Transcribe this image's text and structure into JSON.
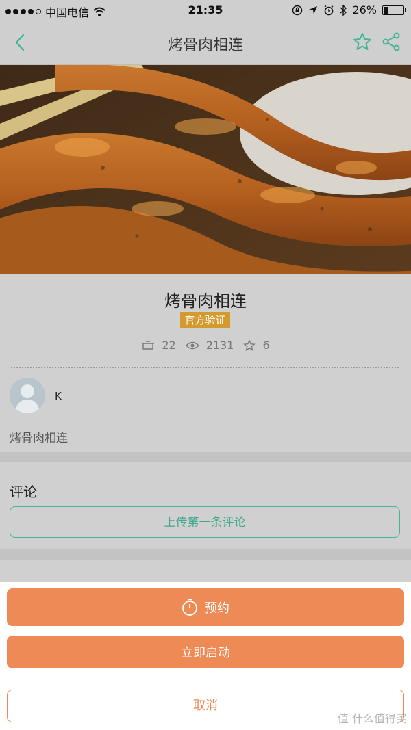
{
  "status_bar": {
    "carrier": "中国电信",
    "time": "21:35",
    "battery": "26%",
    "battery_level": 0.26
  },
  "nav": {
    "title": "烤骨肉相连",
    "back_icon": "chevron-left-icon",
    "favorite_icon": "star-icon",
    "share_icon": "share-icon",
    "accent_color": "#46b49a"
  },
  "recipe": {
    "title": "烤骨肉相连",
    "badge": "官方验证",
    "stats": {
      "cooked": "22",
      "views": "2131",
      "favorites": "6"
    },
    "author": "K",
    "description": "烤骨肉相连"
  },
  "comments": {
    "label": "评论",
    "upload_button": "上传第一条评论"
  },
  "action_sheet": {
    "schedule_label": "预约",
    "start_label": "立即启动",
    "cancel_label": "取消",
    "primary_color": "#ee8a55"
  },
  "watermark": "值 什么值得买"
}
